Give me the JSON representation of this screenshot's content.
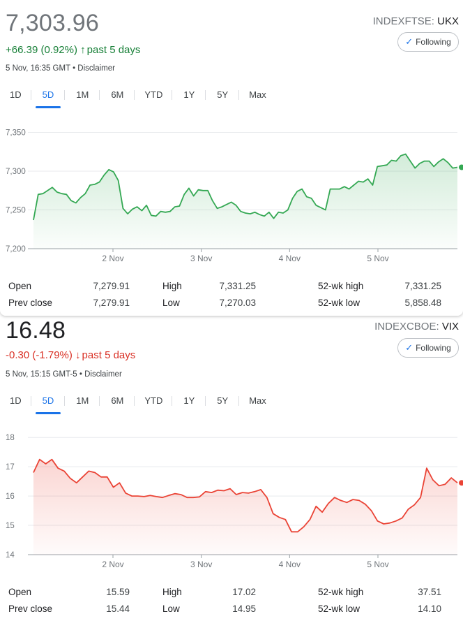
{
  "range_options": [
    "1D",
    "5D",
    "1M",
    "6M",
    "YTD",
    "1Y",
    "5Y",
    "Max"
  ],
  "active_range": "5D",
  "follow_label": "Following",
  "quotes": [
    {
      "price": "7,303.96",
      "exchange": "INDEXFTSE:",
      "symbol": "UKX",
      "change_text": "+66.39 (0.92%)",
      "change_period": "past 5 days",
      "direction": "up",
      "stamp": "5 Nov, 16:35 GMT • Disclaimer",
      "color": "#34a853",
      "stats": {
        "open_label": "Open",
        "open": "7,279.91",
        "prev_close_label": "Prev close",
        "prev_close": "7,279.91",
        "high_label": "High",
        "high": "7,331.25",
        "low_label": "Low",
        "low": "7,270.03",
        "wk52_high_label": "52-wk high",
        "wk52_high": "7,331.25",
        "wk52_low_label": "52-wk low",
        "wk52_low": "5,858.48"
      }
    },
    {
      "price": "16.48",
      "exchange": "INDEXCBOE:",
      "symbol": "VIX",
      "change_text": "-0.30 (-1.79%)",
      "change_period": "past 5 days",
      "direction": "down",
      "stamp": "5 Nov, 15:15 GMT-5 • Disclaimer",
      "color": "#ea4335",
      "stats": {
        "open_label": "Open",
        "open": "15.59",
        "prev_close_label": "Prev close",
        "prev_close": "15.44",
        "high_label": "High",
        "high": "17.02",
        "low_label": "Low",
        "low": "14.95",
        "wk52_high_label": "52-wk high",
        "wk52_high": "37.51",
        "wk52_low_label": "52-wk low",
        "wk52_low": "14.10"
      }
    }
  ],
  "chart_data": [
    {
      "type": "line",
      "series_name": "UKX",
      "y_ticks": [
        "7,200",
        "7,250",
        "7,300",
        "7,350"
      ],
      "y_tick_values": [
        7200,
        7250,
        7300,
        7350
      ],
      "ylim": [
        7200,
        7355
      ],
      "x_labels": [
        "2 Nov",
        "3 Nov",
        "4 Nov",
        "5 Nov"
      ],
      "x_label_positions": [
        9,
        19,
        29,
        39
      ],
      "x_count": 49,
      "values": [
        7237,
        7270,
        7271,
        7275,
        7279,
        7273,
        7271,
        7270,
        7262,
        7259,
        7266,
        7271,
        7282,
        7283,
        7286,
        7295,
        7302,
        7299,
        7288,
        7252,
        7245,
        7251,
        7254,
        7249,
        7256,
        7243,
        7242,
        7248,
        7247,
        7248,
        7254,
        7255,
        7270,
        7278,
        7268,
        7276,
        7275,
        7275,
        7262,
        7252,
        7254,
        7257,
        7260,
        7256,
        7248,
        7246,
        7245,
        7247,
        7244,
        7242,
        7247,
        7239,
        7247,
        7246,
        7250,
        7265,
        7274,
        7277,
        7267,
        7265,
        7256,
        7253,
        7250,
        7277,
        7277,
        7277,
        7280,
        7277,
        7282,
        7287,
        7286,
        7290,
        7282,
        7306,
        7307,
        7308,
        7314,
        7313,
        7320,
        7322,
        7313,
        7304,
        7310,
        7313,
        7313,
        7306,
        7312,
        7316,
        7311,
        7304,
        7305
      ],
      "last_value": 7305,
      "grid": true
    },
    {
      "type": "line",
      "series_name": "VIX",
      "y_ticks": [
        "14",
        "15",
        "16",
        "17",
        "18"
      ],
      "y_tick_values": [
        14,
        15,
        16,
        17,
        18
      ],
      "ylim": [
        14,
        18.1
      ],
      "x_labels": [
        "2 Nov",
        "3 Nov",
        "4 Nov",
        "5 Nov"
      ],
      "x_label_positions": [
        9,
        19,
        29,
        39
      ],
      "x_count": 49,
      "values": [
        16.8,
        17.25,
        17.1,
        17.25,
        16.95,
        16.85,
        16.6,
        16.45,
        16.65,
        16.85,
        16.8,
        16.65,
        16.65,
        16.3,
        16.45,
        16.1,
        16.0,
        16.0,
        15.98,
        16.02,
        15.98,
        15.95,
        16.02,
        16.08,
        16.05,
        15.95,
        15.95,
        15.97,
        16.15,
        16.12,
        16.2,
        16.18,
        16.25,
        16.05,
        16.12,
        16.1,
        16.15,
        16.22,
        15.95,
        15.4,
        15.27,
        15.2,
        14.78,
        14.78,
        14.95,
        15.2,
        15.65,
        15.45,
        15.75,
        15.95,
        15.85,
        15.78,
        15.88,
        15.85,
        15.72,
        15.5,
        15.15,
        15.05,
        15.08,
        15.15,
        15.25,
        15.55,
        15.7,
        15.95,
        16.95,
        16.55,
        16.35,
        16.4,
        16.62,
        16.45
      ],
      "last_value": 16.45,
      "grid": true
    }
  ]
}
